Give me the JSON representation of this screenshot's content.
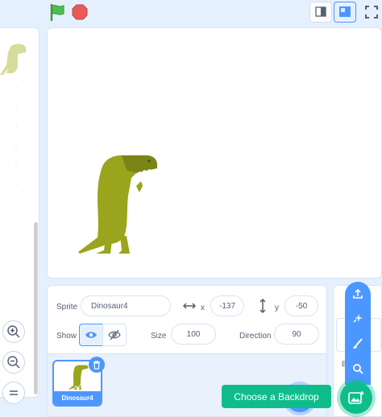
{
  "top": {
    "green_flag_icon": "green-flag-icon",
    "stop_icon": "stop-sign-icon"
  },
  "sprite_info": {
    "sprite_label": "Sprite",
    "sprite_name": "Dinosaur4",
    "x_label": "x",
    "x_value": "-137",
    "y_label": "y",
    "y_value": "-50",
    "show_label": "Show",
    "size_label": "Size",
    "size_value": "100",
    "direction_label": "Direction",
    "direction_value": "90"
  },
  "sprite_list": {
    "tile_label": "Dinosaur4"
  },
  "backdrop": {
    "tooltip": "Choose a Backdrop",
    "pane_text": "B..."
  },
  "colors": {
    "accent_blue": "#4c97ff",
    "backdrop_green": "#0fbd8c",
    "dino_green": "#9aa41c"
  }
}
